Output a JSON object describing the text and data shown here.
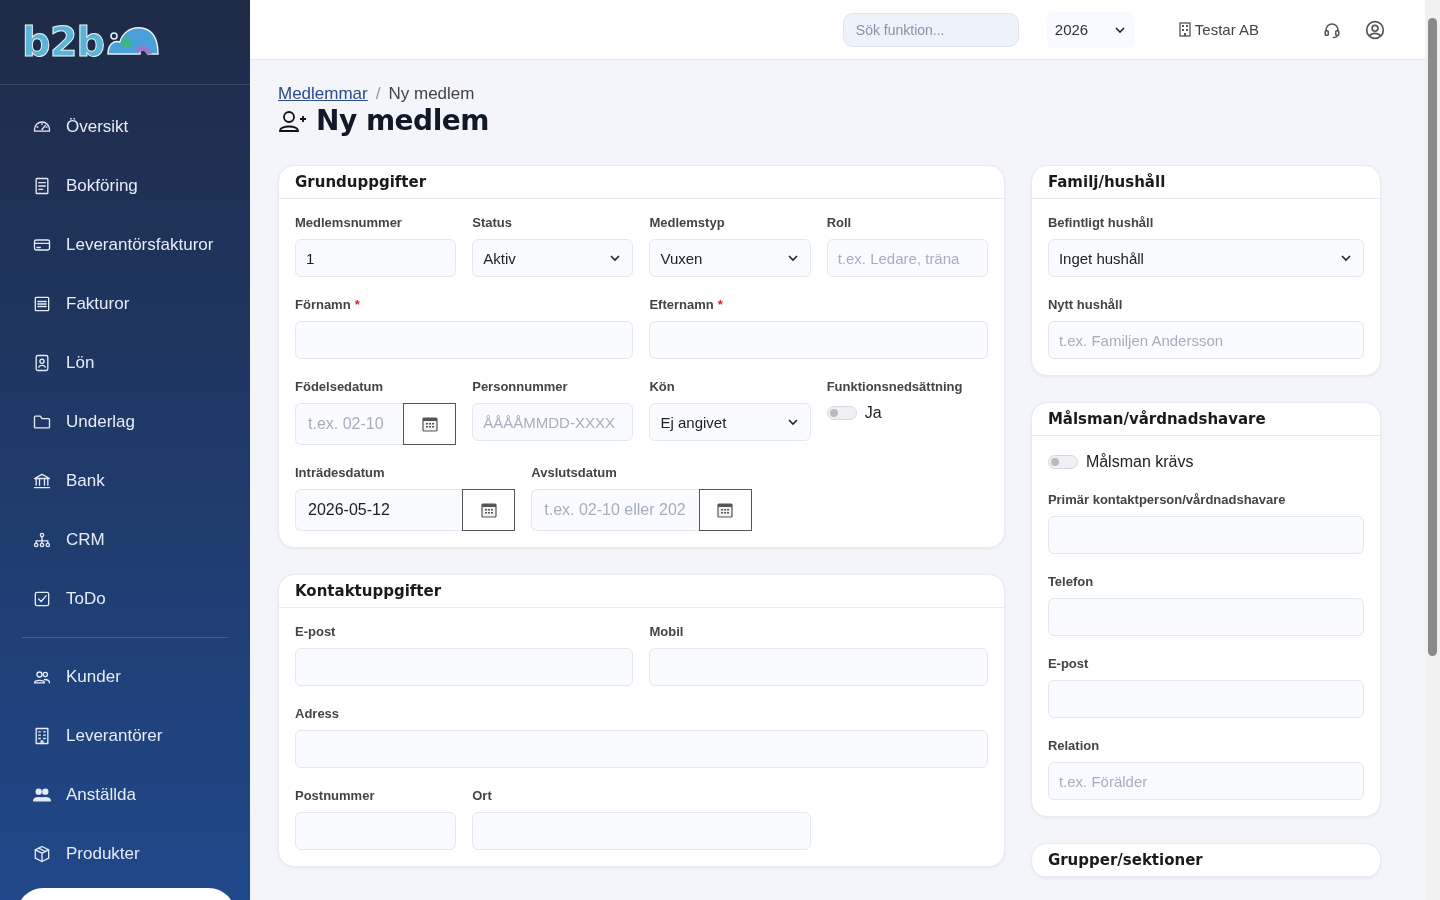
{
  "logo": {
    "text": "b2b"
  },
  "sidebar": {
    "groups": [
      [
        {
          "label": "Översikt",
          "selected": false
        },
        {
          "label": "Bokföring",
          "selected": false
        },
        {
          "label": "Leverantörsfakturor",
          "selected": false
        },
        {
          "label": "Fakturor",
          "selected": false
        },
        {
          "label": "Lön",
          "selected": false
        },
        {
          "label": "Underlag",
          "selected": false
        },
        {
          "label": "Bank",
          "selected": false
        },
        {
          "label": "CRM",
          "selected": false
        },
        {
          "label": "ToDo",
          "selected": false
        }
      ],
      [
        {
          "label": "Kunder",
          "selected": false
        },
        {
          "label": "Leverantörer",
          "selected": false
        },
        {
          "label": "Anställda",
          "selected": false
        },
        {
          "label": "Produkter",
          "selected": false
        }
      ]
    ]
  },
  "header": {
    "search": {
      "placeholder": "Sök funktion..."
    },
    "year": "2026",
    "company": "Testar AB"
  },
  "breadcrumb": {
    "link": "Medlemmar",
    "separator": "/",
    "current": "Ny medlem"
  },
  "title": "Ny medlem",
  "left_cards": [
    {
      "title": "Grunduppgifter",
      "rows": [
        {
          "fields": [
            {
              "label": "Medlemsnummer",
              "kind": "text",
              "value": "1"
            },
            {
              "label": "Status",
              "kind": "select",
              "value": "Aktiv"
            },
            {
              "label": "Medlemstyp",
              "kind": "select",
              "value": "Vuxen"
            },
            {
              "label": "Roll",
              "kind": "text",
              "placeholder": "t.ex. Ledare, träna"
            }
          ]
        },
        {
          "fields": [
            {
              "label": "Förnamn",
              "required_mark": "*",
              "kind": "text"
            },
            {
              "label": "Efternamn",
              "required_mark": "*",
              "kind": "text"
            }
          ]
        },
        {
          "fields": [
            {
              "label": "Födelsedatum",
              "kind": "date",
              "placeholder": "t.ex. 02-10"
            },
            {
              "label": "Personnummer",
              "kind": "text",
              "placeholder": "ÅÅÅÅMMDD-XXXX"
            },
            {
              "label": "Kön",
              "kind": "select",
              "value": "Ej angivet"
            },
            {
              "label": "Funktionsnedsättning",
              "kind": "toggle",
              "on": false,
              "text": "Ja"
            }
          ]
        },
        {
          "fields": [
            {
              "label": "Inträdesdatum",
              "kind": "date",
              "value": "2026-05-12"
            },
            {
              "label": "Avslutsdatum",
              "kind": "date",
              "placeholder": "t.ex. 02-10 eller 202"
            }
          ]
        }
      ]
    },
    {
      "title": "Kontaktuppgifter",
      "rows": [
        {
          "fields": [
            {
              "label": "E-post",
              "kind": "text"
            },
            {
              "label": "Mobil",
              "kind": "text"
            }
          ]
        },
        {
          "fields": [
            {
              "label": "Adress",
              "kind": "text"
            }
          ]
        },
        {
          "fields": [
            {
              "label": "Postnummer",
              "kind": "text"
            },
            {
              "label": "Ort",
              "kind": "text"
            }
          ]
        }
      ]
    }
  ],
  "right_cards": [
    {
      "title": "Familj/hushåll",
      "rows": [
        {
          "fields": [
            {
              "label": "Befintligt hushåll",
              "kind": "select",
              "value": "Inget hushåll"
            }
          ]
        },
        {
          "fields": [
            {
              "label": "Nytt hushåll",
              "kind": "text",
              "placeholder": "t.ex. Familjen Andersson"
            }
          ]
        }
      ]
    },
    {
      "title": "Målsman/vårdnadshavare",
      "rows": [
        {
          "fields": [
            {
              "kind": "toggle",
              "on": false,
              "text": "Målsman krävs"
            }
          ]
        },
        {
          "fields": [
            {
              "label": "Primär kontaktperson/vårdnadshavare",
              "kind": "text"
            }
          ]
        },
        {
          "fields": [
            {
              "label": "Telefon",
              "kind": "text"
            }
          ]
        },
        {
          "fields": [
            {
              "label": "E-post",
              "kind": "text"
            }
          ]
        },
        {
          "fields": [
            {
              "label": "Relation",
              "kind": "text",
              "placeholder": "t.ex. Förälder"
            }
          ]
        }
      ]
    },
    {
      "title": "Grupper/sektioner"
    }
  ]
}
